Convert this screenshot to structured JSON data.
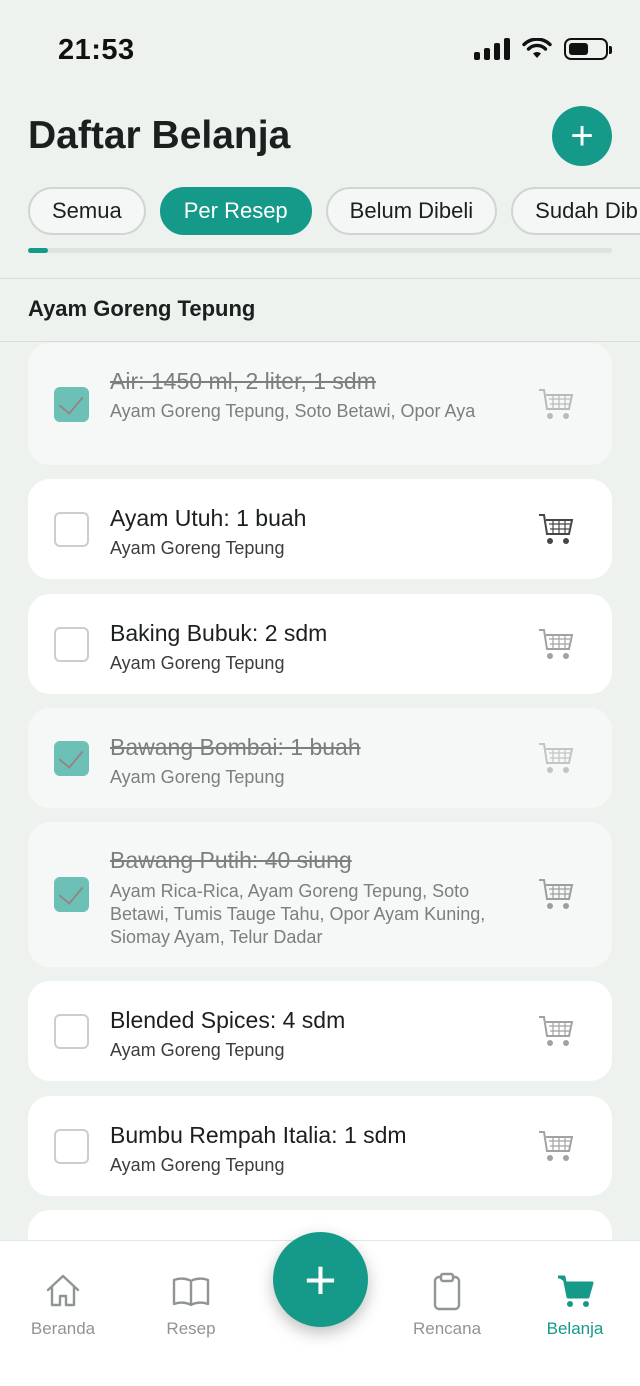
{
  "status_bar": {
    "time": "21:53"
  },
  "header": {
    "title": "Daftar Belanja"
  },
  "filters": [
    {
      "label": "Semua",
      "active": false
    },
    {
      "label": "Per Resep",
      "active": true
    },
    {
      "label": "Belum Dibeli",
      "active": false
    },
    {
      "label": "Sudah Dib",
      "active": false
    }
  ],
  "section": {
    "title": "Ayam Goreng Tepung"
  },
  "items": [
    {
      "title": "Air: 1450 ml, 2 liter, 1 sdm",
      "subtitle": "Ayam Goreng Tepung, Soto Betawi, Opor Aya",
      "checked": true
    },
    {
      "title": "Ayam Utuh: 1 buah",
      "subtitle": "Ayam Goreng Tepung",
      "checked": false
    },
    {
      "title": "Baking Bubuk: 2 sdm",
      "subtitle": "Ayam Goreng Tepung",
      "checked": false
    },
    {
      "title": "Bawang Bombai: 1 buah",
      "subtitle": "Ayam Goreng Tepung",
      "checked": true
    },
    {
      "title": "Bawang Putih: 40 siung",
      "subtitle": "Ayam Rica-Rica, Ayam Goreng Tepung, Soto Betawi, Tumis Tauge Tahu, Opor Ayam Kuning, Siomay Ayam, Telur Dadar",
      "checked": true
    },
    {
      "title": "Blended Spices: 4 sdm",
      "subtitle": "Ayam Goreng Tepung",
      "checked": false
    },
    {
      "title": "Bumbu Rempah Italia: 1 sdm",
      "subtitle": "Ayam Goreng Tepung",
      "checked": false
    }
  ],
  "bottom_nav": [
    {
      "label": "Beranda",
      "icon": "home-icon",
      "active": false
    },
    {
      "label": "Resep",
      "icon": "book-icon",
      "active": false
    },
    {
      "label": "Rencana",
      "icon": "clipboard-icon",
      "active": false
    },
    {
      "label": "Belanja",
      "icon": "cart-icon",
      "active": true
    }
  ],
  "colors": {
    "accent": "#159a8a",
    "background": "#eef2ef",
    "checked_box": "#6cc0b5"
  }
}
